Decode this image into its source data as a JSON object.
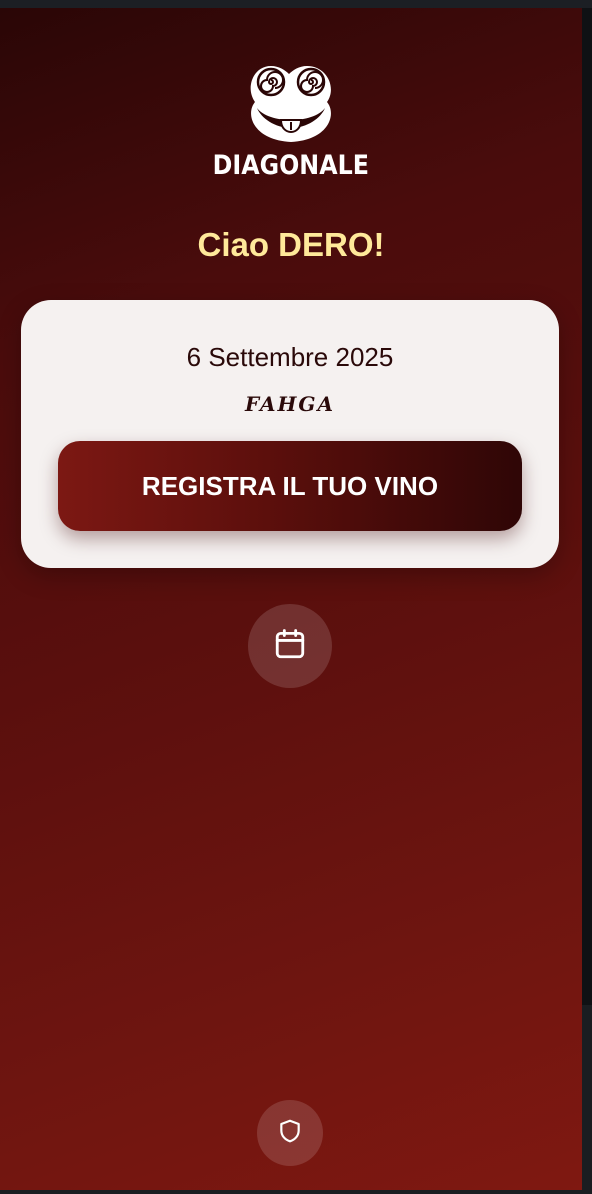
{
  "logo": {
    "brand": "DIAGONALE",
    "icon": "smiling-face-logo"
  },
  "greeting": "Ciao DERO!",
  "card": {
    "date": "6 Settembre 2025",
    "signature": "FAHGA",
    "cta_label": "REGISTRA IL TUO VINO"
  },
  "actions": {
    "calendar_icon": "calendar-icon",
    "shield_icon": "shield-icon"
  },
  "colors": {
    "greeting": "#ffe99a",
    "card_background": "#f5f1f0",
    "cta_start": "#7c1813",
    "cta_end": "#2f0606",
    "background_dark": "#2a0606",
    "background_light": "#7f1811"
  }
}
